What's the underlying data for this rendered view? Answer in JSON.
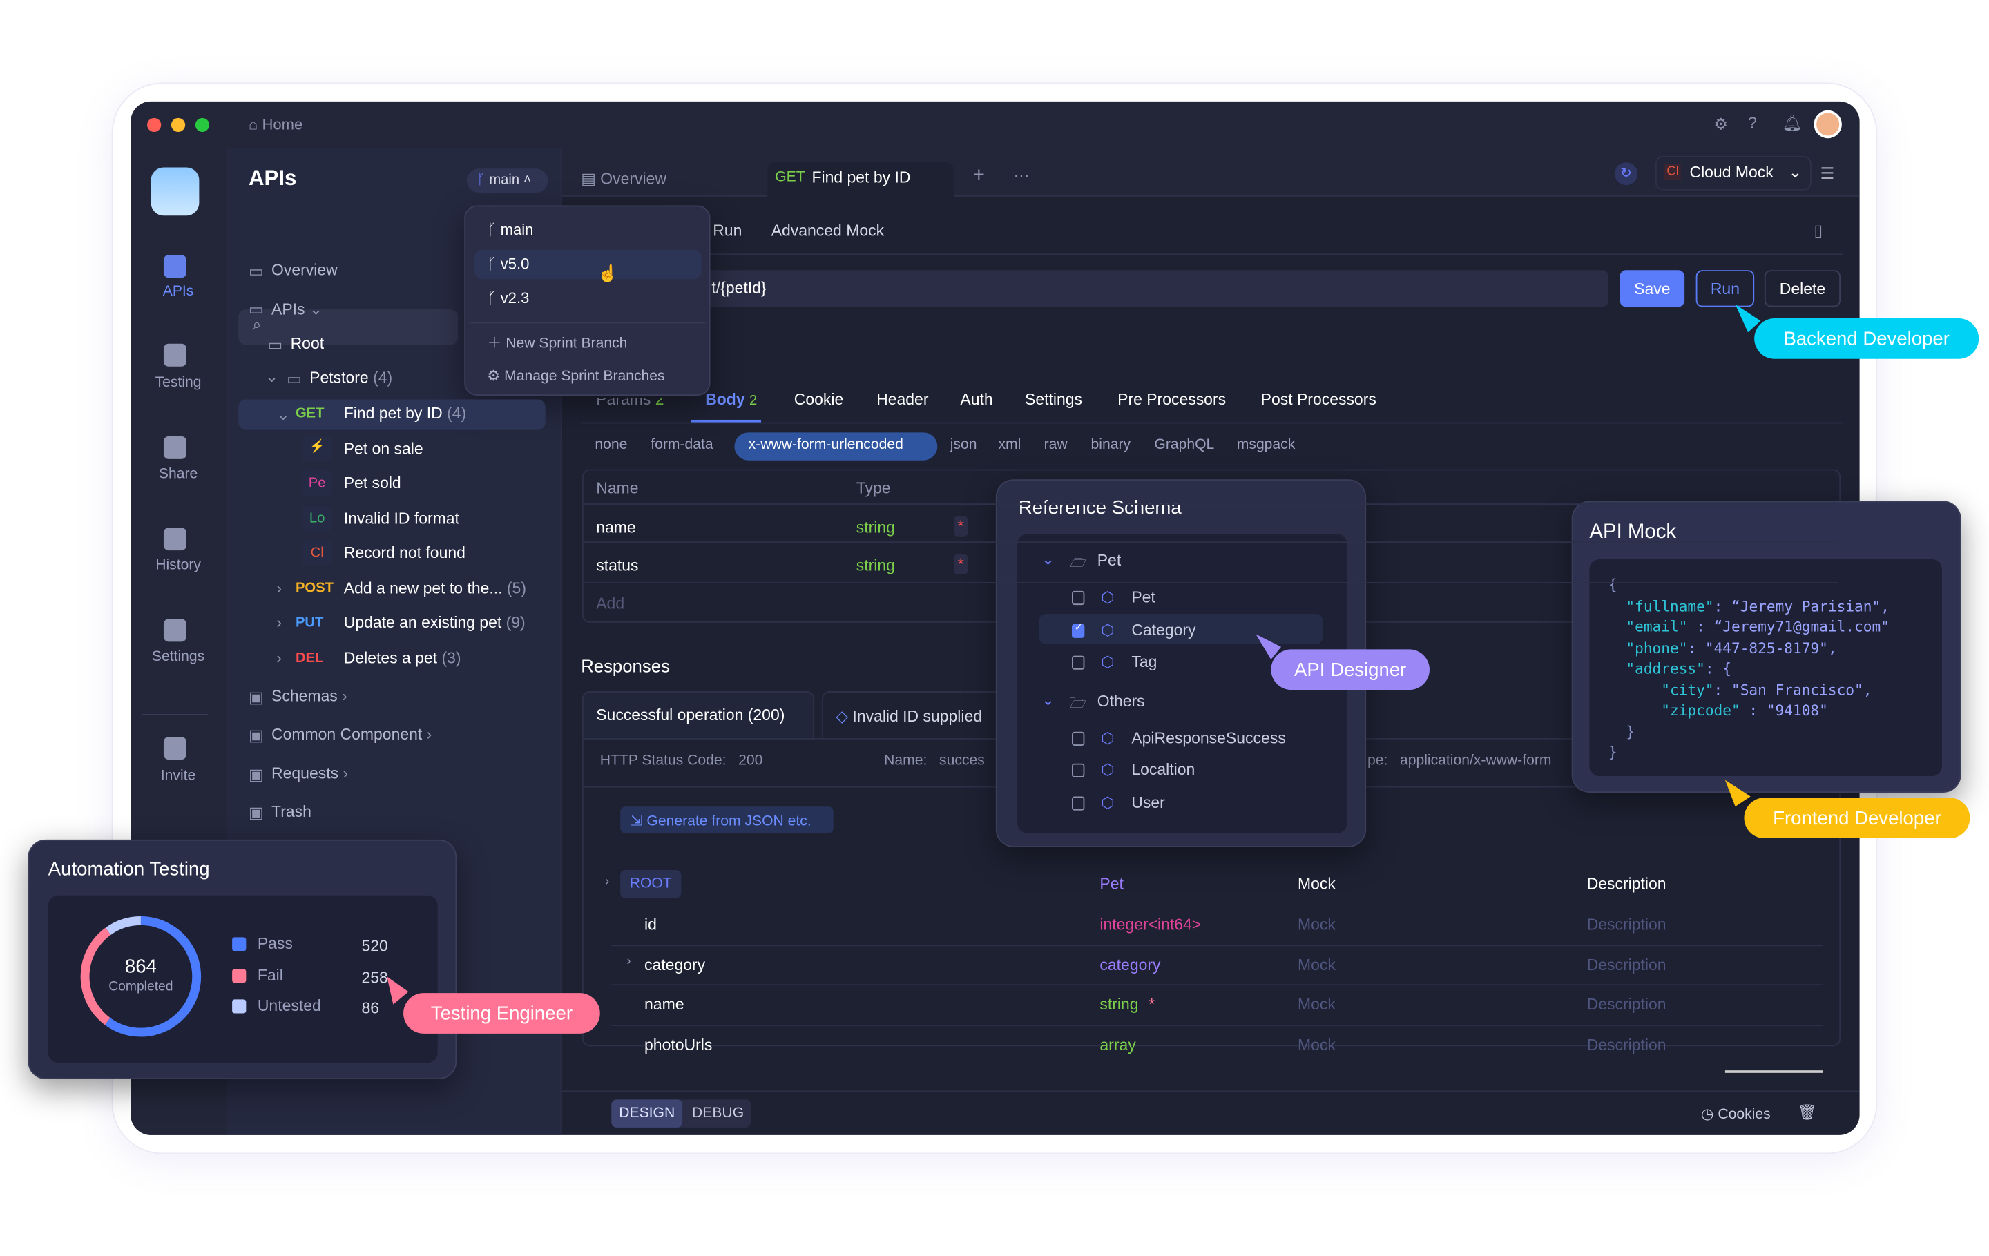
{
  "window": {
    "home": "Home",
    "traffic_colors": [
      "#ff5f57",
      "#febc2e",
      "#28c840"
    ]
  },
  "rail": {
    "items": [
      {
        "label": "APIs",
        "active": true
      },
      {
        "label": "Testing"
      },
      {
        "label": "Share"
      },
      {
        "label": "History"
      },
      {
        "label": "Settings"
      },
      {
        "label": "Invite"
      }
    ]
  },
  "sidebar": {
    "title": "APIs",
    "branch": "main",
    "tree": [
      {
        "label": "Overview"
      },
      {
        "label": "APIs"
      },
      {
        "label": "Root"
      },
      {
        "label": "Petstore",
        "count": "(4)"
      },
      {
        "method": "GET",
        "label": "Find pet by ID",
        "count": "(4)"
      },
      {
        "badge": "",
        "label": "Pet on sale"
      },
      {
        "badge": "Pe",
        "label": "Pet sold"
      },
      {
        "badge": "Lo",
        "label": "Invalid ID format"
      },
      {
        "badge": "Cl",
        "label": "Record not found"
      },
      {
        "method": "POST",
        "label": "Add a new pet to the...",
        "count": "(5)"
      },
      {
        "method": "PUT",
        "label": "Update an existing pet",
        "count": "(9)"
      },
      {
        "method": "DEL",
        "label": "Deletes a pet",
        "count": "(3)"
      },
      {
        "label": "Schemas"
      },
      {
        "label": "Common Component"
      },
      {
        "label": "Requests"
      },
      {
        "label": "Trash"
      }
    ]
  },
  "branch_menu": {
    "branches": [
      "main",
      "v5.0",
      "v2.3"
    ],
    "hovered": "v5.0",
    "new": "New Sprint Branch",
    "manage": "Manage Sprint Branches"
  },
  "tabs": {
    "overview": "Overview",
    "active_method": "GET",
    "active": "Find pet by ID",
    "env": "Cloud Mock",
    "env_badge": "Cl"
  },
  "subtabs": [
    "Run",
    "Advanced Mock"
  ],
  "url": {
    "value": "t/{petId}"
  },
  "actions": {
    "save": "Save",
    "run": "Run",
    "delete": "Delete"
  },
  "req_tabs": {
    "params": "Params",
    "params_count": "2",
    "body": "Body",
    "body_count": "2",
    "others": [
      "Cookie",
      "Header",
      "Auth",
      "Settings",
      "Pre Processors",
      "Post Processors"
    ]
  },
  "body_types": {
    "items": [
      "none",
      "form-data",
      "x-www-form-urlencoded",
      "json",
      "xml",
      "raw",
      "binary",
      "GraphQL",
      "msgpack"
    ],
    "selected": "x-www-form-urlencoded"
  },
  "params_table": {
    "headers": [
      "Name",
      "Type"
    ],
    "rows": [
      {
        "name": "name",
        "type": "string",
        "required": "*"
      },
      {
        "name": "status",
        "type": "string",
        "required": "*"
      }
    ],
    "add": "Add"
  },
  "responses": {
    "title": "Responses",
    "tabs": [
      "Successful operation (200)",
      "Invalid ID supplied"
    ],
    "status_label": "HTTP Status Code:",
    "status": "200",
    "name_label": "Name:",
    "name": "succes",
    "type_label": "pe:",
    "type": "application/x-www-form",
    "generate": "Generate from JSON etc."
  },
  "schema_table": {
    "root": "ROOT",
    "root_type": "Pet",
    "mock_header": "Mock",
    "desc_header": "Description",
    "rows": [
      {
        "name": "id",
        "type": "integer<int64>",
        "type_color": "#e0439a"
      },
      {
        "name": "category",
        "type": "category",
        "type_color": "#9b7dff",
        "expand": true
      },
      {
        "name": "name",
        "type": "string",
        "type_color": "#7ccf4a",
        "required": "*"
      },
      {
        "name": "photoUrls",
        "type": "array",
        "type_color": "#7ccf4a"
      }
    ],
    "mock": "Mock",
    "desc": "Description"
  },
  "bottom": {
    "design": "DESIGN",
    "debug": "DEBUG",
    "cookies": "Cookies"
  },
  "ref_schema": {
    "title": "Reference Schema",
    "groups": [
      {
        "label": "Pet",
        "items": [
          {
            "label": "Pet",
            "checked": false
          },
          {
            "label": "Category",
            "checked": true
          },
          {
            "label": "Tag",
            "checked": false
          }
        ]
      },
      {
        "label": "Others",
        "items": [
          {
            "label": "ApiResponseSuccess",
            "checked": false
          },
          {
            "label": "Localtion",
            "checked": false
          },
          {
            "label": "User",
            "checked": false
          }
        ]
      }
    ]
  },
  "api_mock": {
    "title": "API Mock",
    "lines": [
      {
        "i": 0,
        "t": "{"
      },
      {
        "i": 1,
        "k": "\"fullname\"",
        "v": ": “Jeremy Parisian\","
      },
      {
        "i": 1,
        "k": "\"email\"",
        "v": " : “Jeremy71@gmail.com\""
      },
      {
        "i": 1,
        "k": "\"phone\"",
        "v": ": \"447-825-8179\","
      },
      {
        "i": 1,
        "k": "\"address\"",
        "v": ": {"
      },
      {
        "i": 2,
        "k": "\"city\"",
        "v": ": \"San Francisco\","
      },
      {
        "i": 2,
        "k": "\"zipcode\"",
        "v": " : \"94108\""
      },
      {
        "i": 1,
        "t": "}"
      },
      {
        "i": 0,
        "t": "}"
      }
    ]
  },
  "automation": {
    "title": "Automation Testing",
    "total": "864",
    "total_label": "Completed",
    "legend": [
      {
        "label": "Pass",
        "value": 520,
        "color": "#4b7bff"
      },
      {
        "label": "Fail",
        "value": 258,
        "color": "#ff7a95"
      },
      {
        "label": "Untested",
        "value": 86,
        "color": "#b9cbff"
      }
    ]
  },
  "roles": {
    "backend": {
      "label": "Backend Developer",
      "color": "#00d2f5"
    },
    "designer": {
      "label": "API Designer",
      "color": "#9b87f5"
    },
    "frontend": {
      "label": "Frontend Developer",
      "color": "#fbbf0c"
    },
    "tester": {
      "label": "Testing Engineer",
      "color": "#ff7494"
    }
  }
}
